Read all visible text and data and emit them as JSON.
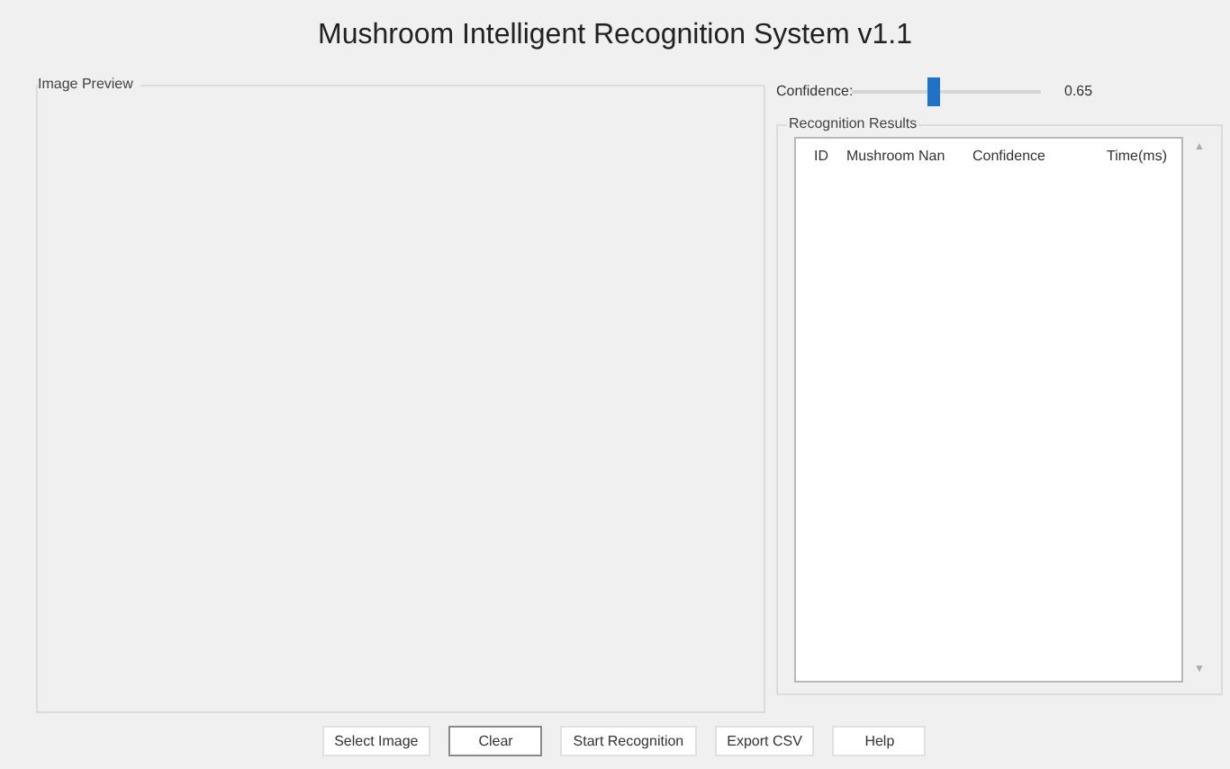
{
  "window": {
    "title": "Mushroom Intelligent Recognition System v1.1"
  },
  "image_preview": {
    "title": "Image Preview"
  },
  "confidence": {
    "label": "Confidence:",
    "level": 0.43,
    "reading": "0.65"
  },
  "results": {
    "title": "Recognition Results",
    "table": {
      "columns": [
        "ID",
        "Mushroom Nan",
        "Confidence",
        "Time(ms)"
      ]
    },
    "scroll_up": "▲",
    "scroll_down": "▼"
  },
  "buttons": [
    {
      "label": "Select Image",
      "focused": false
    },
    {
      "label": "Clear",
      "focused": true
    },
    {
      "label": "Start Recognition",
      "focused": false
    },
    {
      "label": "Export CSV",
      "focused": false
    },
    {
      "label": "Help",
      "focused": false
    }
  ]
}
